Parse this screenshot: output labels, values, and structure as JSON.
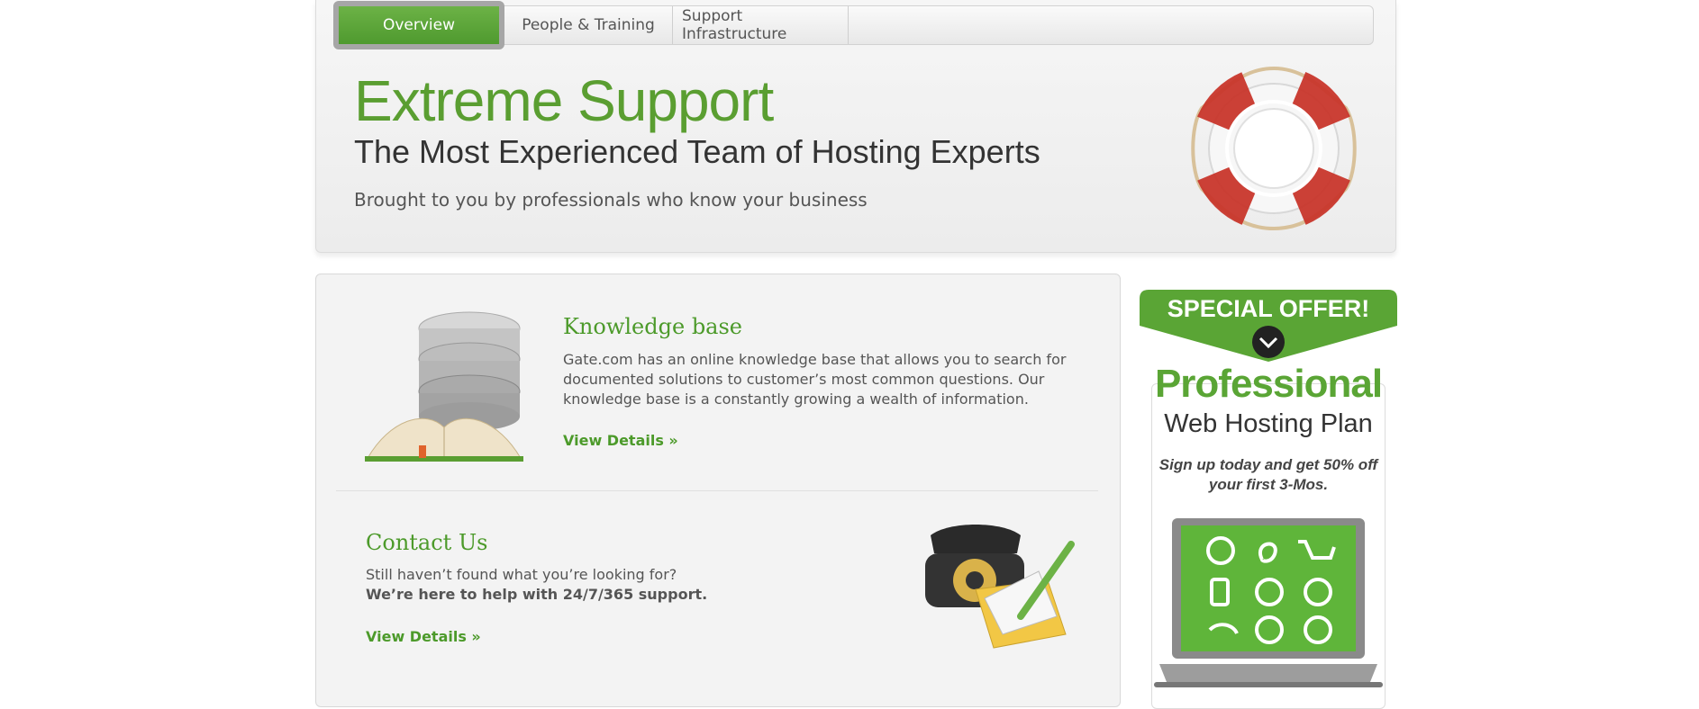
{
  "tabs": [
    {
      "label": "Overview",
      "active": true
    },
    {
      "label": "People & Training",
      "active": false
    },
    {
      "label": "Support Infrastructure",
      "active": false
    }
  ],
  "hero": {
    "title": "Extreme Support",
    "subtitle": "The Most Experienced Team of Hosting Experts",
    "tagline": "Brought to you by professionals who know your business"
  },
  "knowledge_base": {
    "title": "Knowledge base",
    "text": "Gate.com has an online knowledge base that allows you to search for documented solutions to customer’s most common questions. Our knowledge base is a constantly growing a wealth of information.",
    "link": "View Details »"
  },
  "contact": {
    "title": "Contact Us",
    "line1": "Still haven’t found what you’re looking for?",
    "line2": "We’re here to help with 24/7/365 support.",
    "link": "View Details »"
  },
  "offer": {
    "banner": "SPECIAL OFFER!",
    "headline": "Professional",
    "plan": "Web Hosting Plan",
    "promo": "Sign up today and get 50% off your first 3-Mos."
  },
  "colors": {
    "accent_green": "#5a9e31",
    "link_green": "#4c9a2a",
    "lifebuoy_red": "#c8362b"
  },
  "icons": [
    "lifebuoy-icon",
    "database-book-icon",
    "phone-envelope-icon",
    "chevron-down-icon",
    "laptop-icon"
  ]
}
